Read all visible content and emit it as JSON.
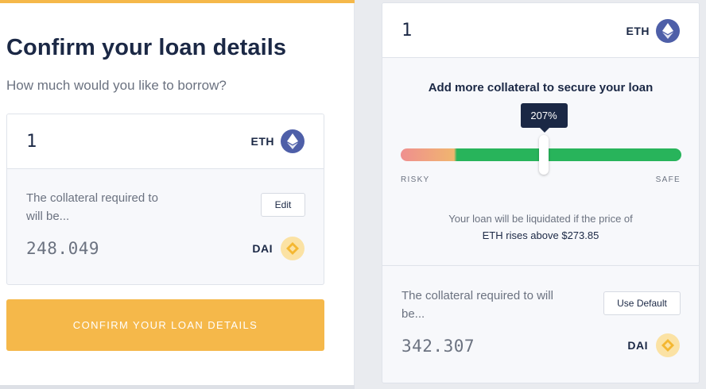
{
  "left": {
    "title": "Confirm your loan details",
    "subtitle": "How much would you like to borrow?",
    "amount": "1",
    "amount_token": "ETH",
    "collateral_text": "The collateral required to will be...",
    "edit_label": "Edit",
    "collateral_value": "248.049",
    "collateral_token": "DAI",
    "confirm_label": "CONFIRM YOUR LOAN DETAILS"
  },
  "right": {
    "amount": "1",
    "amount_token": "ETH",
    "heading": "Add more collateral to secure your loan",
    "tooltip": "207%",
    "risky_label": "RISKY",
    "safe_label": "SAFE",
    "liquidation_line1": "Your loan will be liquidated if the price of",
    "liquidation_line2": "ETH rises above $273.85",
    "collateral_text": "The collateral required to will be...",
    "use_default_label": "Use Default",
    "collateral_value": "342.307",
    "collateral_token": "DAI"
  },
  "slider": {
    "collateral_ratio_percent": 207,
    "thumb_position_fraction": 0.51
  },
  "colors": {
    "accent": "#f5b84a",
    "navy": "#1b2845",
    "eth": "#4e5fa8",
    "dai": "#f4b731",
    "safe_green": "#28b45b",
    "risky_red": "#ef8f8f"
  },
  "icons": {
    "eth": "ethereum-icon",
    "dai": "dai-icon"
  }
}
